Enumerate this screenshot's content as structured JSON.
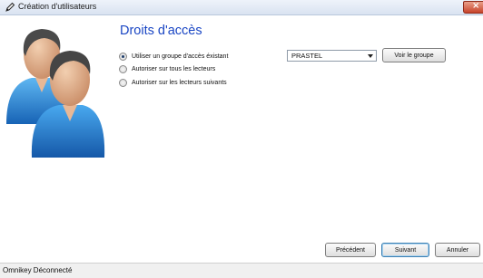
{
  "window": {
    "title": "Création d'utilisateurs",
    "title_icon": "pencil-icon",
    "close_icon": "close-icon",
    "close_glyph": "×"
  },
  "illustration": {
    "icon": "users-icon"
  },
  "section": {
    "title": "Droits d'accès"
  },
  "options": [
    {
      "label": "Utiliser un groupe d'accès éxistant",
      "checked": true
    },
    {
      "label": "Autoriser sur tous les lecteurs",
      "checked": false
    },
    {
      "label": "Autoriser sur les lecteurs suivants",
      "checked": false
    }
  ],
  "group_select": {
    "value": "PRASTEL"
  },
  "buttons": {
    "view_group": "Voir le groupe",
    "previous": "Précédent",
    "next": "Suivant",
    "cancel": "Annuler"
  },
  "status": {
    "text": "Omnikey Déconnecté"
  },
  "colors": {
    "title_blue": "#1a46c4",
    "close_red": "#c7432a",
    "shirt_blue": "#1f8ee0"
  }
}
